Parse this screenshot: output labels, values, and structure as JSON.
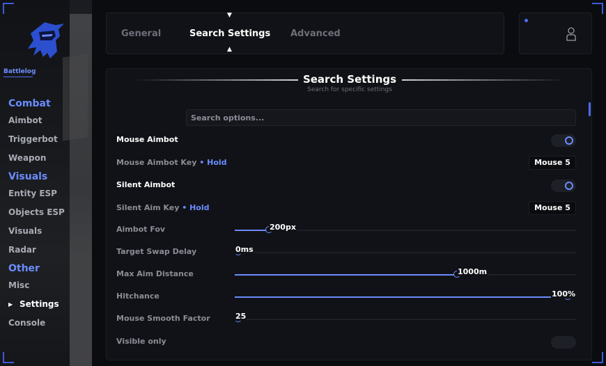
{
  "brand": {
    "name": "Battlelog"
  },
  "colors": {
    "accent": "#6b8cff",
    "background": "#0b0c10",
    "panel": "#111217"
  },
  "sidebar": {
    "sections": [
      {
        "title": "Combat",
        "items": [
          "Aimbot",
          "Triggerbot",
          "Weapon"
        ]
      },
      {
        "title": "Visuals",
        "items": [
          "Entity ESP",
          "Objects ESP",
          "Visuals",
          "Radar"
        ]
      },
      {
        "title": "Other",
        "items": [
          "Misc",
          "Settings",
          "Console"
        ]
      }
    ],
    "active_item": "Settings"
  },
  "tabs": [
    {
      "label": "General",
      "active": false
    },
    {
      "label": "Search Settings",
      "active": true
    },
    {
      "label": "Advanced",
      "active": false
    }
  ],
  "profile": {
    "icon": "user-icon",
    "status_dot": true
  },
  "panel": {
    "title": "Search Settings",
    "subtitle": "Search for specific settings",
    "search_placeholder": "Search options..."
  },
  "settings": [
    {
      "label": "Mouse Aimbot",
      "type": "toggle",
      "on": true,
      "bright": true
    },
    {
      "label": "Mouse Aimbot Key",
      "type": "key",
      "mode": "Hold",
      "key": "Mouse 5"
    },
    {
      "label": "Silent Aimbot",
      "type": "toggle",
      "on": true,
      "bright": true
    },
    {
      "label": "Silent Aim Key",
      "type": "key",
      "mode": "Hold",
      "key": "Mouse 5"
    },
    {
      "label": "Aimbot Fov",
      "type": "slider",
      "value_text": "200px",
      "fraction": 0.1
    },
    {
      "label": "Target Swap Delay",
      "type": "slider",
      "value_text": "0ms",
      "fraction": 0.0
    },
    {
      "label": "Max Aim Distance",
      "type": "slider",
      "value_text": "1000m",
      "fraction": 0.65
    },
    {
      "label": "Hitchance",
      "type": "slider",
      "value_text": "100%",
      "fraction": 1.0
    },
    {
      "label": "Mouse Smooth Factor",
      "type": "slider",
      "value_text": "25",
      "fraction": 0.0
    },
    {
      "label": "Visible only",
      "type": "toggle",
      "on": false,
      "bright": false
    }
  ]
}
